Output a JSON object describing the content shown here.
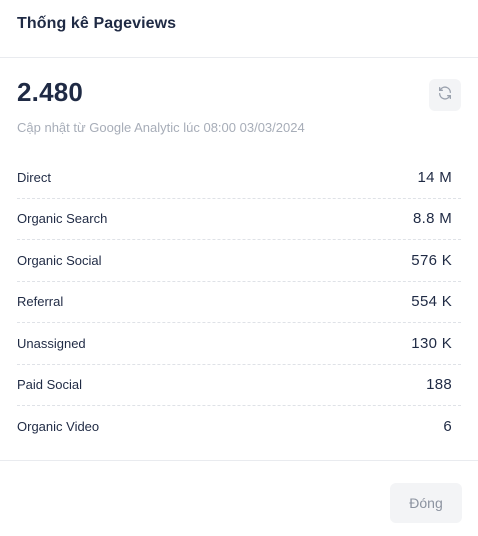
{
  "header": {
    "title": "Thống kê Pageviews"
  },
  "summary": {
    "total": "2.480",
    "updated_text": "Cập nhật từ Google Analytic lúc 08:00 03/03/2024",
    "refresh_icon": "refresh-icon"
  },
  "sources": [
    {
      "label": "Direct",
      "value": "14 M"
    },
    {
      "label": "Organic Search",
      "value": "8.8 M"
    },
    {
      "label": "Organic Social",
      "value": "576 K"
    },
    {
      "label": "Referral",
      "value": "554 K"
    },
    {
      "label": "Unassigned",
      "value": "130 K"
    },
    {
      "label": "Paid Social",
      "value": "188"
    },
    {
      "label": "Organic Video",
      "value": "6"
    }
  ],
  "footer": {
    "close_label": "Đóng"
  }
}
